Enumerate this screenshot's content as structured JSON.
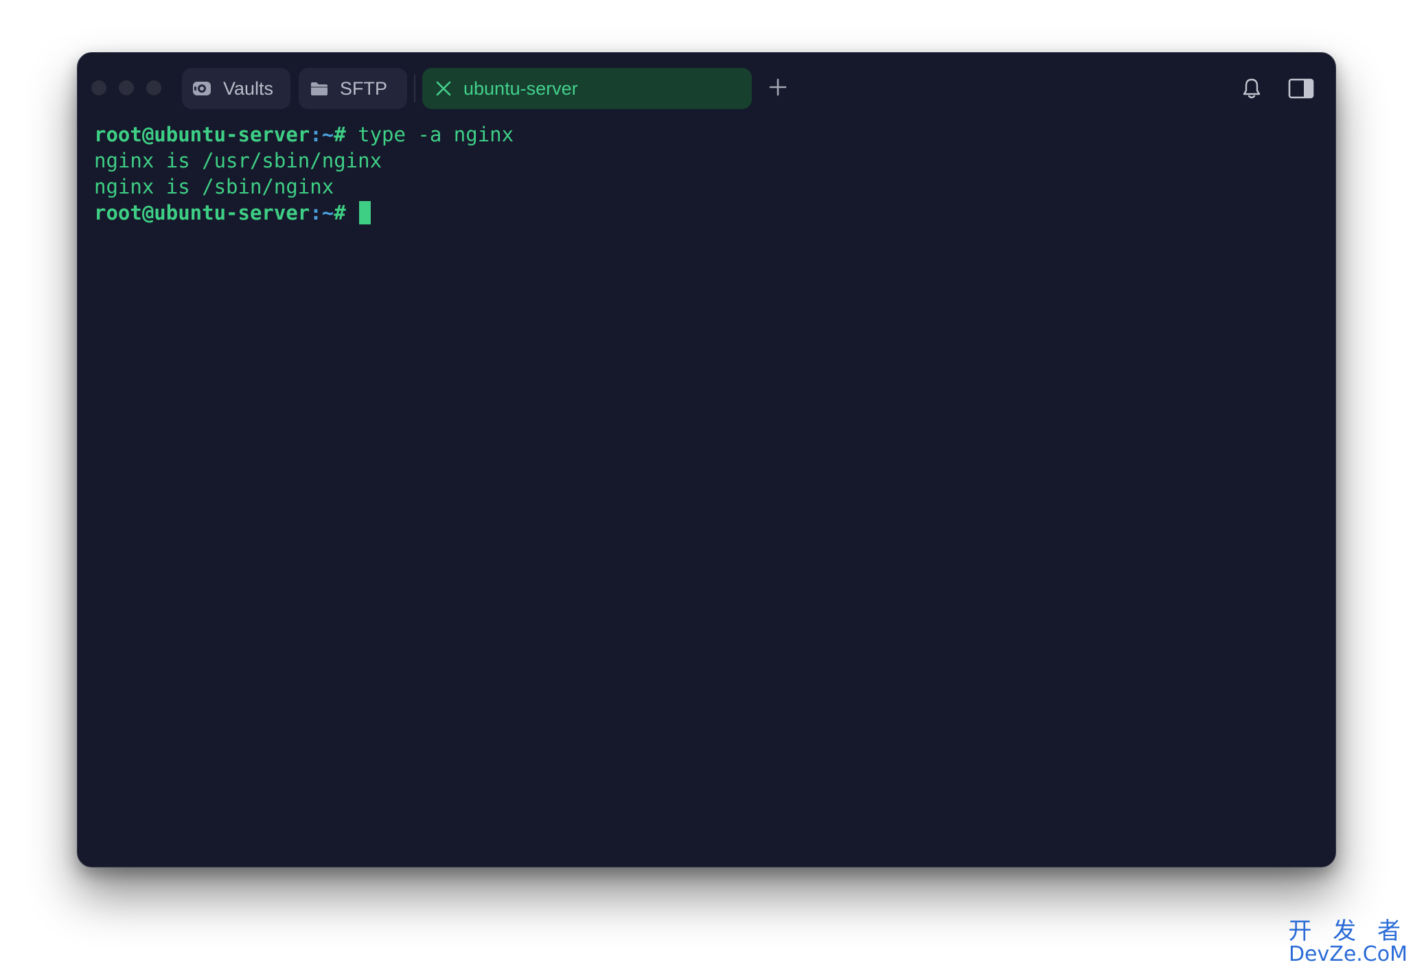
{
  "window": {
    "tabs": [
      {
        "label": "Vaults",
        "icon": "vault-icon"
      },
      {
        "label": "SFTP",
        "icon": "folder-icon"
      },
      {
        "label": "ubuntu-server",
        "icon": "close-icon",
        "active": true
      }
    ],
    "add_tab_icon": "plus-icon",
    "toolbar_icons": [
      "bell-icon",
      "sidebar-toggle-icon"
    ]
  },
  "terminal": {
    "lines": [
      {
        "prompt_user": "root@ubuntu-server",
        "prompt_sep": ":~",
        "prompt_hash": "#",
        "command": " type -a nginx"
      },
      {
        "output": "nginx is /usr/sbin/nginx"
      },
      {
        "output": "nginx is /sbin/nginx"
      },
      {
        "prompt_user": "root@ubuntu-server",
        "prompt_sep": ":~",
        "prompt_hash": "#",
        "command": " "
      }
    ]
  },
  "watermark": {
    "cn": "开 发 者",
    "en": "DevZe.CoM"
  },
  "colors": {
    "background": "#16182b",
    "accent_green": "#3ecf85",
    "active_tab_bg": "#17402f",
    "path_blue": "#4a9fd9",
    "watermark_blue": "#2a6bd6"
  }
}
